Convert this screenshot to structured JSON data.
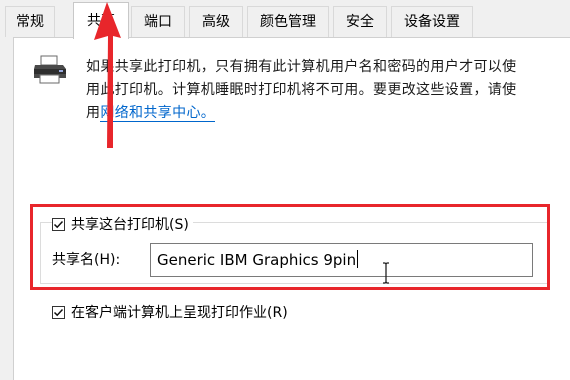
{
  "tabs": [
    {
      "label": "常规",
      "active": false
    },
    {
      "label": "共享",
      "active": true
    },
    {
      "label": "端口",
      "active": false
    },
    {
      "label": "高级",
      "active": false
    },
    {
      "label": "颜色管理",
      "active": false
    },
    {
      "label": "安全",
      "active": false
    },
    {
      "label": "设备设置",
      "active": false
    }
  ],
  "description": {
    "line1": "如果共享此打印机，只有拥有此计算机用户名和密码的用户才可以使",
    "line2": "用此打印机。计算机睡眠时打印机将不可用。要更改这些设置，请使",
    "line3_prefix": "用",
    "link": "网络和共享中心。"
  },
  "share_printer": {
    "label": "共享这台打印机(S)",
    "checked": true
  },
  "share_name": {
    "label": "共享名(H):",
    "value": "Generic IBM Graphics 9pin"
  },
  "render_jobs": {
    "label": "在客户端计算机上呈现打印作业(R)",
    "checked": true
  },
  "icons": [
    "printer-icon",
    "checkmark-icon",
    "text-cursor-icon",
    "annotation-arrow-icon"
  ],
  "colors": {
    "annotation": "#e8262b",
    "link": "#0066cc",
    "panel": "#ffffff",
    "tabbar": "#f0f0f0"
  }
}
